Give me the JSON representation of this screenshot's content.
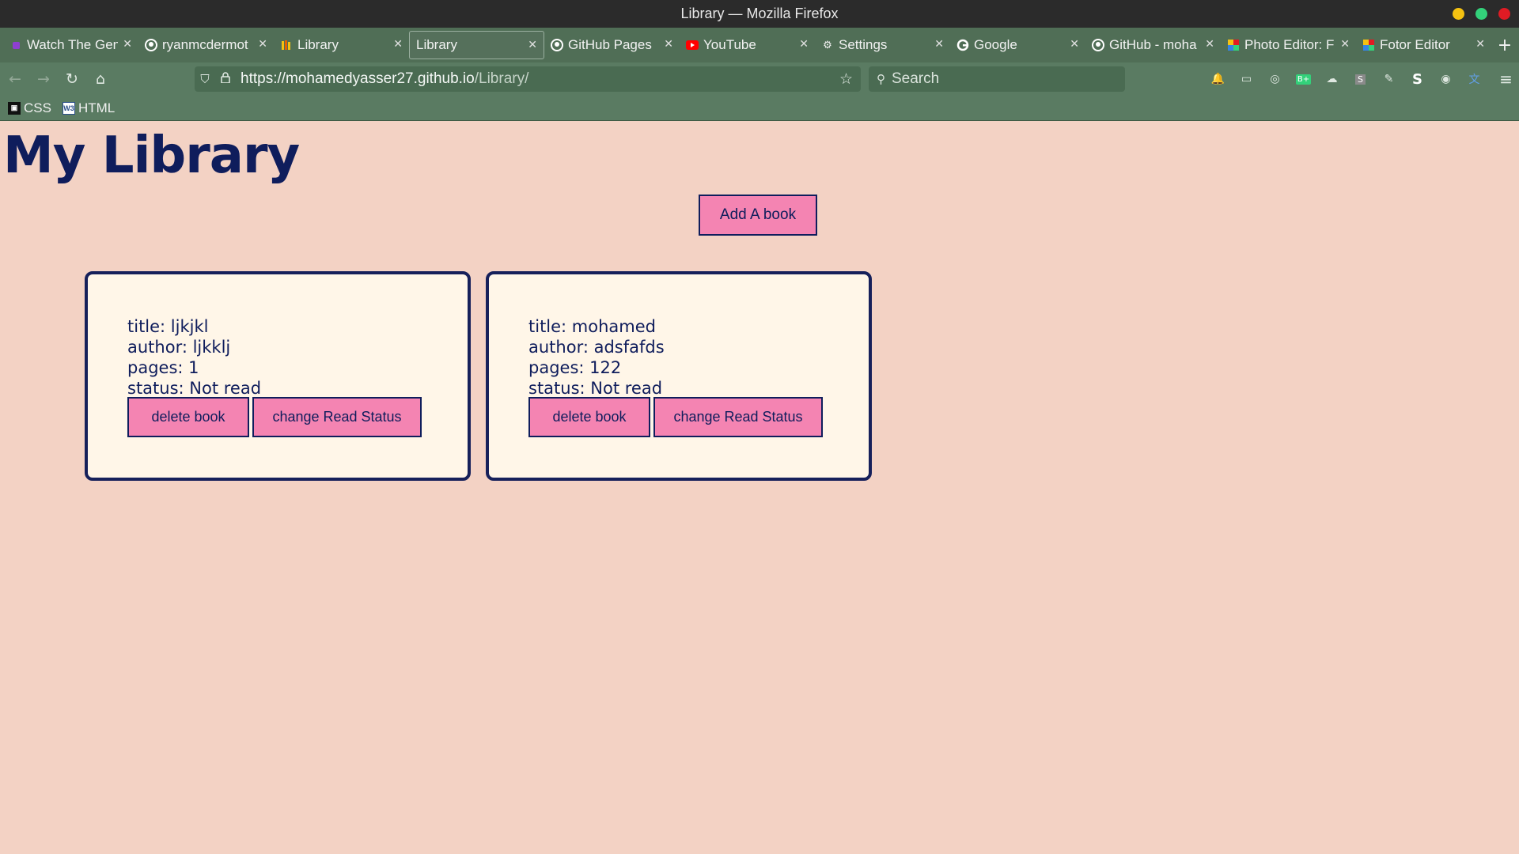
{
  "window": {
    "title": "Library — Mozilla Firefox"
  },
  "tabs": [
    {
      "label": "Watch The Gen",
      "icon": "purple-square-icon",
      "color": "#8e3fd1"
    },
    {
      "label": "ryanmcdermot",
      "icon": "github-icon",
      "color": "#ffffff"
    },
    {
      "label": "Library",
      "icon": "library-icon",
      "color": "#f5c211"
    },
    {
      "label": "Library",
      "icon": "none",
      "color": ""
    },
    {
      "label": "GitHub Pages",
      "icon": "github-icon",
      "color": "#ffffff"
    },
    {
      "label": "YouTube",
      "icon": "youtube-icon",
      "color": "#ff0000"
    },
    {
      "label": "Settings",
      "icon": "gear-icon",
      "color": "#ffffff"
    },
    {
      "label": "Google",
      "icon": "google-icon",
      "color": "#ffffff"
    },
    {
      "label": "GitHub - moha",
      "icon": "github-icon",
      "color": "#ffffff"
    },
    {
      "label": "Photo Editor: F",
      "icon": "fotor-icon",
      "color": "#f5c211"
    },
    {
      "label": "Fotor Editor",
      "icon": "fotor-icon",
      "color": "#f5c211"
    }
  ],
  "active_tab_index": 3,
  "urlbar": {
    "host": "https://mohamedyasser27.github.io",
    "path": "/Library/"
  },
  "search": {
    "placeholder": "Search"
  },
  "bookmarks": [
    {
      "label": "CSS",
      "icon": "css-bookmark-icon"
    },
    {
      "label": "HTML",
      "icon": "w3schools-icon"
    }
  ],
  "page": {
    "title": "My Library",
    "add_button": "Add A book"
  },
  "books": [
    {
      "title": "title: ljkjkl",
      "author": "author: ljkklj",
      "pages": "pages: 1",
      "status": "status: Not read",
      "delete_label": "delete book",
      "change_label": "change Read Status"
    },
    {
      "title": "title: mohamed",
      "author": "author: adsfafds",
      "pages": "pages: 122",
      "status": "status: Not read",
      "delete_label": "delete book",
      "change_label": "change Read Status"
    }
  ],
  "colors": {
    "page_bg": "#f3d2c4",
    "accent_pink": "#f484b2",
    "navy": "#0f1d5c",
    "card_bg": "#fff6e8",
    "toolbar_green": "#5a7b62"
  }
}
